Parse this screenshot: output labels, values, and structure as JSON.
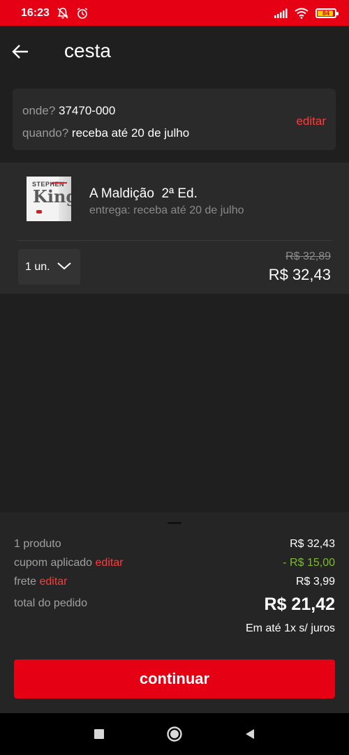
{
  "status_bar": {
    "time": "16:23",
    "battery": "84",
    "icons": [
      "bell-off-icon",
      "alarm-icon",
      "signal-icon",
      "wifi-icon",
      "battery-icon"
    ]
  },
  "header": {
    "title": "cesta",
    "back_icon": "arrow-left-icon"
  },
  "delivery": {
    "where_label": "onde?",
    "where_value": "37470-000",
    "when_label": "quando?",
    "when_value": "receba até 20 de julho",
    "edit_label": "editar"
  },
  "item": {
    "cover": {
      "top_text": "STEPHEN",
      "author_text": "King"
    },
    "title": "A Maldição  2ª Ed.",
    "delivery": "entrega: receba até 20 de julho",
    "quantity": "1 un.",
    "old_price": "R$ 32,89",
    "price": "R$ 32,43"
  },
  "summary": {
    "products_label": "1 produto",
    "products_value": "R$ 32,43",
    "coupon_label": "cupom aplicado",
    "coupon_edit": "editar",
    "coupon_value": "- R$ 15,00",
    "shipping_label": "frete",
    "shipping_edit": "editar",
    "shipping_value": "R$ 3,99",
    "total_label": "total do pedido",
    "total_value": "R$ 21,42",
    "installments": "Em até 1x s/ juros",
    "continue_label": "continuar"
  },
  "colors": {
    "brand_red": "#e60014",
    "edit_red": "#ff3b3b",
    "discount_green": "#7dbb2e",
    "background": "#1f1f1f",
    "card": "#2a2a2a"
  },
  "nav": {
    "icons": [
      "square-recents-icon",
      "circle-home-icon",
      "triangle-back-icon"
    ]
  }
}
